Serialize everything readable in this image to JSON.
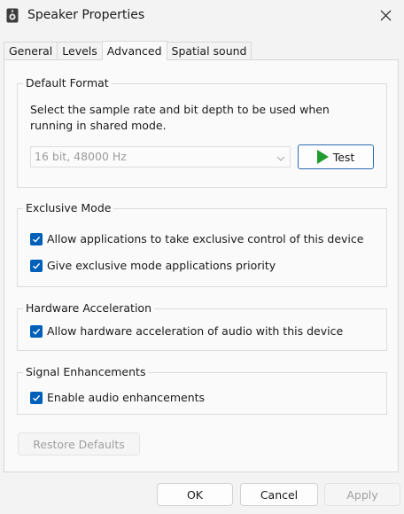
{
  "window": {
    "title": "Speaker Properties"
  },
  "tabs": [
    {
      "label": "General"
    },
    {
      "label": "Levels"
    },
    {
      "label": "Advanced"
    },
    {
      "label": "Spatial sound"
    }
  ],
  "default_format": {
    "title": "Default Format",
    "description": "Select the sample rate and bit depth to be used when running in shared mode.",
    "selected_format": "16 bit, 48000 Hz",
    "test_label": "Test"
  },
  "exclusive_mode": {
    "title": "Exclusive Mode",
    "options": [
      {
        "label": "Allow applications to take exclusive control of this device",
        "checked": true
      },
      {
        "label": "Give exclusive mode applications priority",
        "checked": true
      }
    ]
  },
  "hardware_acceleration": {
    "title": "Hardware Acceleration",
    "options": [
      {
        "label": "Allow hardware acceleration of audio with this device",
        "checked": true
      }
    ]
  },
  "signal_enhancements": {
    "title": "Signal Enhancements",
    "options": [
      {
        "label": "Enable audio enhancements",
        "checked": true
      }
    ]
  },
  "restore_defaults_label": "Restore Defaults",
  "footer": {
    "ok_label": "OK",
    "cancel_label": "Cancel",
    "apply_label": "Apply"
  },
  "colors": {
    "accent": "#005fb8",
    "test_border": "#2f6cb2",
    "play_icon": "#1e9d2e"
  }
}
